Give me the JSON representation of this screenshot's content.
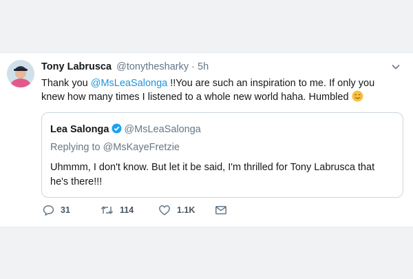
{
  "tweet": {
    "author_name": "Tony Labrusca",
    "author_handle": "@tonythesharky",
    "separator": "·",
    "time": "5h",
    "text_parts": {
      "before": "Thank you ",
      "mention": "@MsLeaSalonga",
      "after": " !!You are such an inspiration to me. If only you knew how many times I listened to a whole new world haha. Humbled"
    },
    "emoji": "smiling-face-emoji"
  },
  "quote": {
    "name": "Lea Salonga",
    "handle": "@MsLeaSalonga",
    "replying_to": "Replying to @MsKayeFretzie",
    "text": "Uhmmm, I don't know. But let it be said, I'm thrilled for Tony Labrusca that he's there!!!"
  },
  "actions": {
    "reply_count": "31",
    "retweet_count": "114",
    "like_count": "1.1K"
  },
  "colors": {
    "link": "#1b95e0",
    "secondary_text": "#657786",
    "verified": "#1da1f2"
  }
}
